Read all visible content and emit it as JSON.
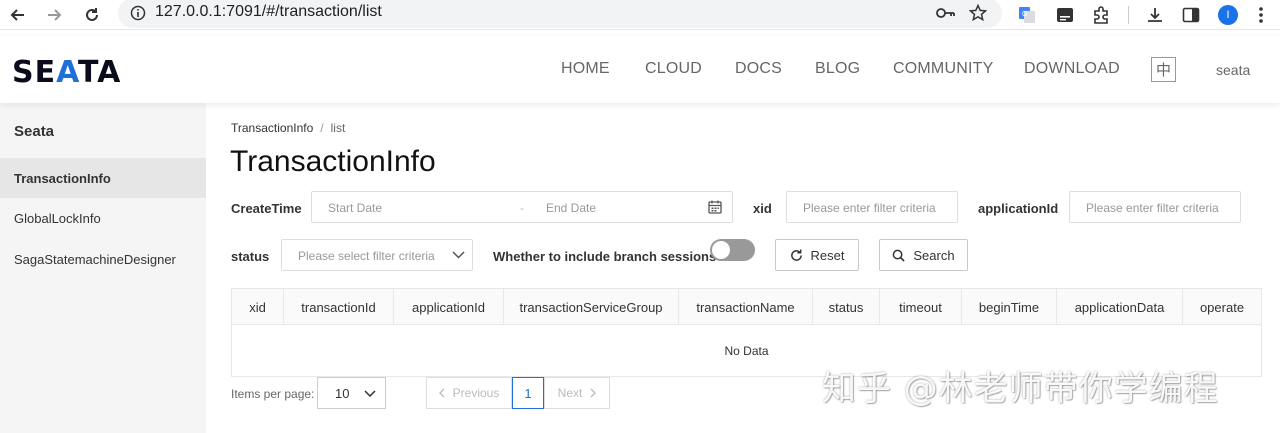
{
  "browser": {
    "url": "127.0.0.1:7091/#/transaction/list",
    "profile_initial": "I"
  },
  "header": {
    "logo": {
      "part1": "SE",
      "part2": "A",
      "part3": "TA"
    },
    "nav": [
      "HOME",
      "CLOUD",
      "DOCS",
      "BLOG",
      "COMMUNITY",
      "DOWNLOAD"
    ],
    "lang_label": "中",
    "user": "seata"
  },
  "sidebar": {
    "title": "Seata",
    "items": [
      {
        "label": "TransactionInfo",
        "active": true
      },
      {
        "label": "GlobalLockInfo",
        "active": false
      },
      {
        "label": "SagaStatemachineDesigner",
        "active": false
      }
    ]
  },
  "breadcrumb": {
    "parent": "TransactionInfo",
    "sep": "/",
    "current": "list"
  },
  "page_title": "TransactionInfo",
  "filters": {
    "create_time_label": "CreateTime",
    "start_date_placeholder": "Start Date",
    "date_separator": "-",
    "end_date_placeholder": "End Date",
    "xid_label": "xid",
    "xid_placeholder": "Please enter filter criteria",
    "application_id_label": "applicationId",
    "application_id_placeholder": "Please enter filter criteria",
    "status_label": "status",
    "status_placeholder": "Please select filter criteria",
    "branch_sessions_label": "Whether to include branch sessions",
    "branch_sessions_on": false,
    "reset_label": "Reset",
    "search_label": "Search"
  },
  "table": {
    "columns": [
      "xid",
      "transactionId",
      "applicationId",
      "transactionServiceGroup",
      "transactionName",
      "status",
      "timeout",
      "beginTime",
      "applicationData",
      "operate"
    ],
    "empty_text": "No Data"
  },
  "pagination": {
    "per_page_label": "Items per page:",
    "per_page_value": "10",
    "previous_label": "Previous",
    "current_page": "1",
    "next_label": "Next"
  },
  "watermark": "知乎 @林老师带你学编程",
  "colors": {
    "logo_accent": "#1f6fd9",
    "sidebar_bg": "#f5f5f5",
    "active_item_bg": "#e6e6e6",
    "current_page": "#1f6fd9"
  }
}
